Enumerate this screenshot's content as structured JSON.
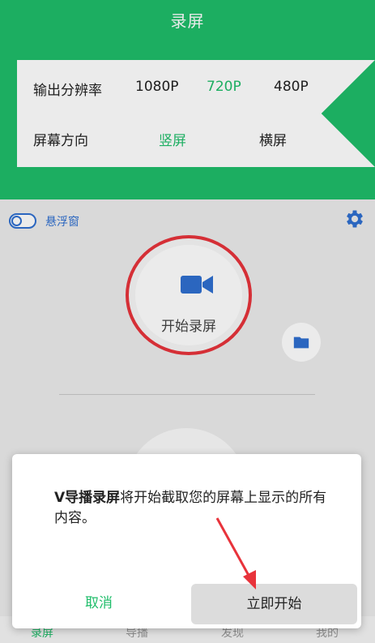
{
  "header": {
    "title": "录屏"
  },
  "settings": {
    "resolution_label": "输出分辨率",
    "resolution_options": [
      "1080P",
      "720P",
      "480P"
    ],
    "resolution_selected": "720P",
    "orientation_label": "屏幕方向",
    "orientation_options": [
      "竖屏",
      "横屏"
    ],
    "orientation_selected": "竖屏"
  },
  "floating_window": {
    "label": "悬浮窗",
    "enabled": false
  },
  "record": {
    "label": "开始录屏"
  },
  "dialog": {
    "app_name": "V导播录屏",
    "message": "将开始截取您的屏幕上显示的所有内容。",
    "cancel_label": "取消",
    "start_label": "立即开始"
  },
  "bottom_nav": {
    "items": [
      "录屏",
      "导播",
      "发现",
      "我的"
    ],
    "active": "录屏"
  },
  "colors": {
    "brand_green": "#1fbd6a",
    "accent_blue": "#2f6fd0",
    "record_red": "#e8333b"
  }
}
